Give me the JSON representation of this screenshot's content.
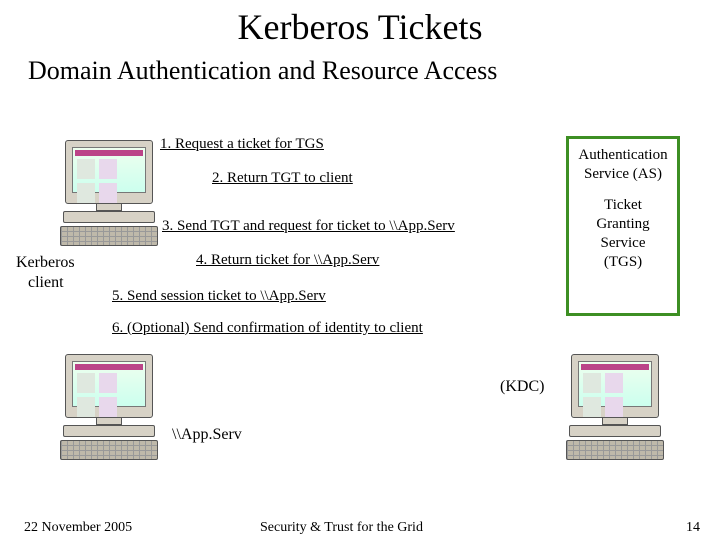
{
  "title": "Kerberos Tickets",
  "subtitle": "Domain Authentication and Resource Access",
  "steps": {
    "s1": "1. Request a ticket for TGS",
    "s2": "2. Return TGT to client",
    "s3": "3. Send TGT and request for ticket to \\\\App.Serv",
    "s4": "4. Return ticket for \\\\App.Serv",
    "s5": "5. Send session ticket to \\\\App.Serv",
    "s6": "6. (Optional) Send confirmation of identity to client"
  },
  "server": {
    "line1": "Authentication",
    "line2": "Service (AS)",
    "line3": "Ticket",
    "line4": "Granting",
    "line5": "Service",
    "line6": "(TGS)"
  },
  "labels": {
    "client1": "Kerberos",
    "client2": "client",
    "kdc": "(KDC)",
    "appserv": "\\\\App.Serv"
  },
  "footer": {
    "date": "22 November 2005",
    "mid": "Security & Trust for the Grid",
    "page": "14"
  }
}
